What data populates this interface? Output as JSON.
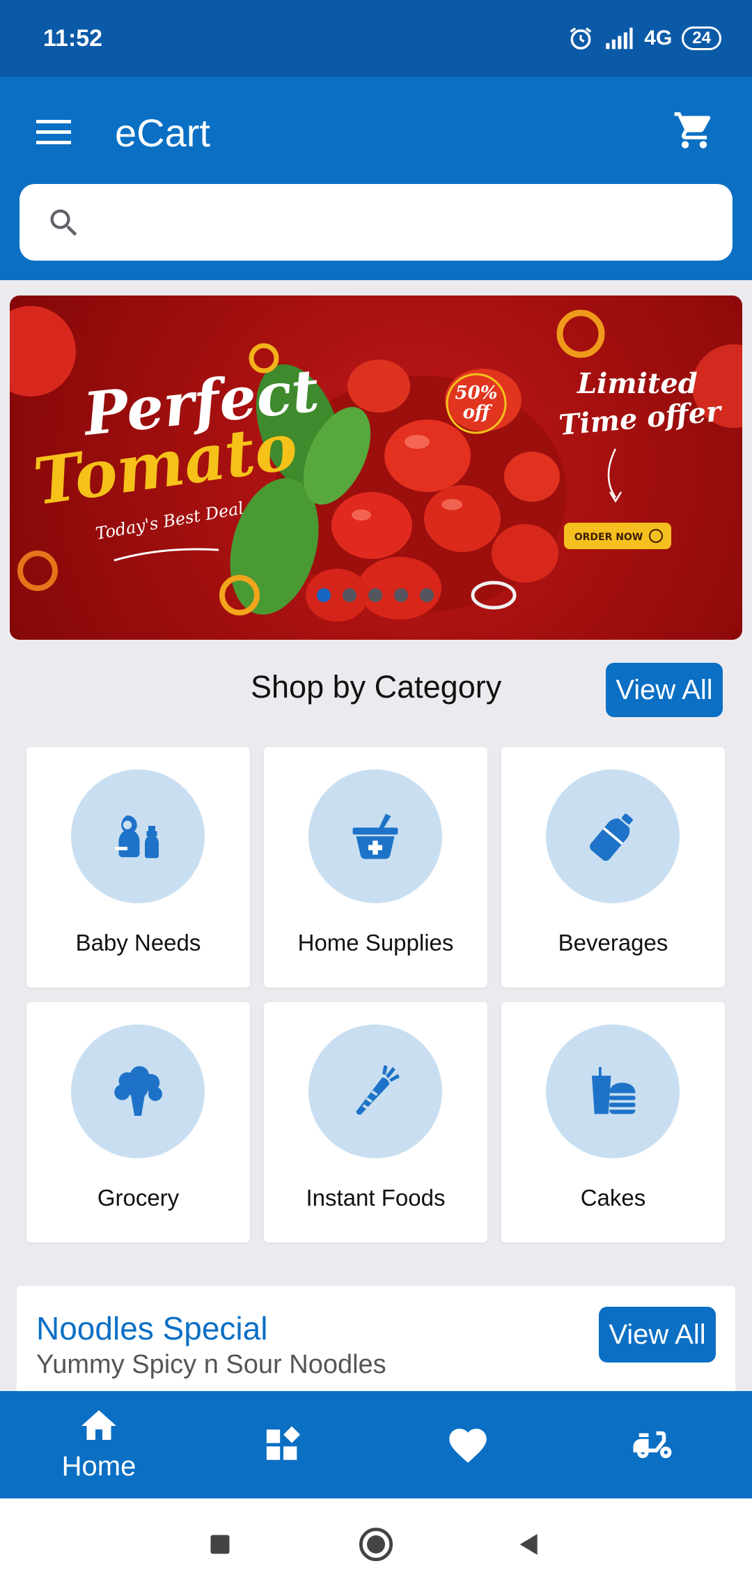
{
  "status_bar": {
    "time": "11:52",
    "network": "4G",
    "battery": "24"
  },
  "app_bar": {
    "title": "eCart"
  },
  "search": {
    "placeholder": ""
  },
  "banner": {
    "slides": 5,
    "active_slide": 1
  },
  "categories_section": {
    "title": "Shop by Category",
    "view_all_label": "View All",
    "items": [
      {
        "label": "Baby Needs",
        "icon": "baby-bottle-icon"
      },
      {
        "label": "Home Supplies",
        "icon": "medicine-basket-icon"
      },
      {
        "label": "Beverages",
        "icon": "bottle-icon"
      },
      {
        "label": "Grocery",
        "icon": "broccoli-icon"
      },
      {
        "label": "Instant Foods",
        "icon": "carrot-icon"
      },
      {
        "label": "Cakes",
        "icon": "burger-drink-icon"
      }
    ]
  },
  "promo": {
    "title": "Noodles Special",
    "subtitle": "Yummy Spicy n Sour Noodles",
    "view_all_label": "View All"
  },
  "bottom_nav": {
    "items": [
      {
        "label": "Home",
        "icon": "home-icon",
        "active": true
      },
      {
        "label": "",
        "icon": "categories-icon"
      },
      {
        "label": "",
        "icon": "heart-icon"
      },
      {
        "label": "",
        "icon": "delivery-scooter-icon"
      }
    ]
  },
  "colors": {
    "primary": "#0b6fc4",
    "status_bar": "#0b5aa8",
    "background": "#ebebef",
    "category_circle": "#c9dff1"
  }
}
